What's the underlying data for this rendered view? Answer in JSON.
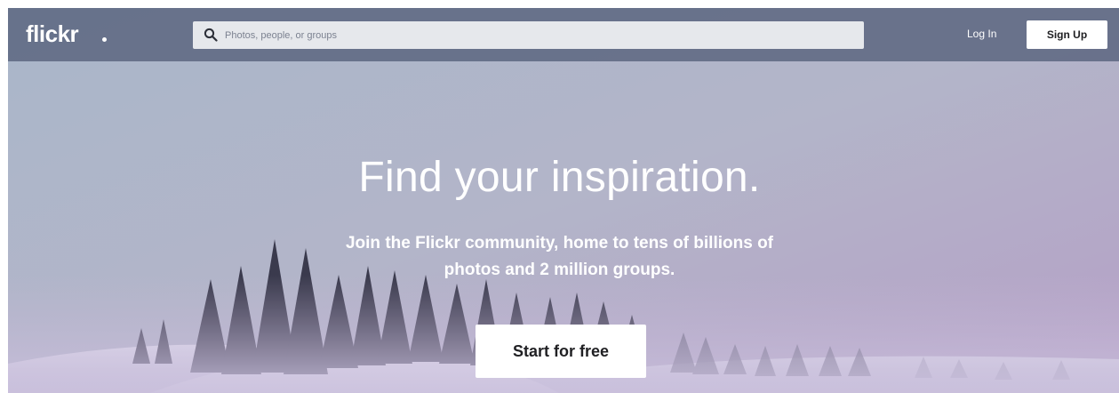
{
  "brand": {
    "logo_text": "flickr"
  },
  "header": {
    "search_placeholder": "Photos, people, or groups",
    "login_label": "Log In",
    "signup_label": "Sign Up"
  },
  "hero": {
    "headline": "Find your inspiration.",
    "subline_1": "Join the Flickr community, home to tens of billions of",
    "subline_2": "photos and 2 million groups.",
    "cta_label": "Start for free"
  },
  "icons": {
    "search": "search-icon"
  },
  "colors": {
    "topbar": "#545f7a",
    "search_bg": "#e6e8ec",
    "button_bg": "#ffffff",
    "button_text": "#212124",
    "text_light": "#ffffff"
  }
}
